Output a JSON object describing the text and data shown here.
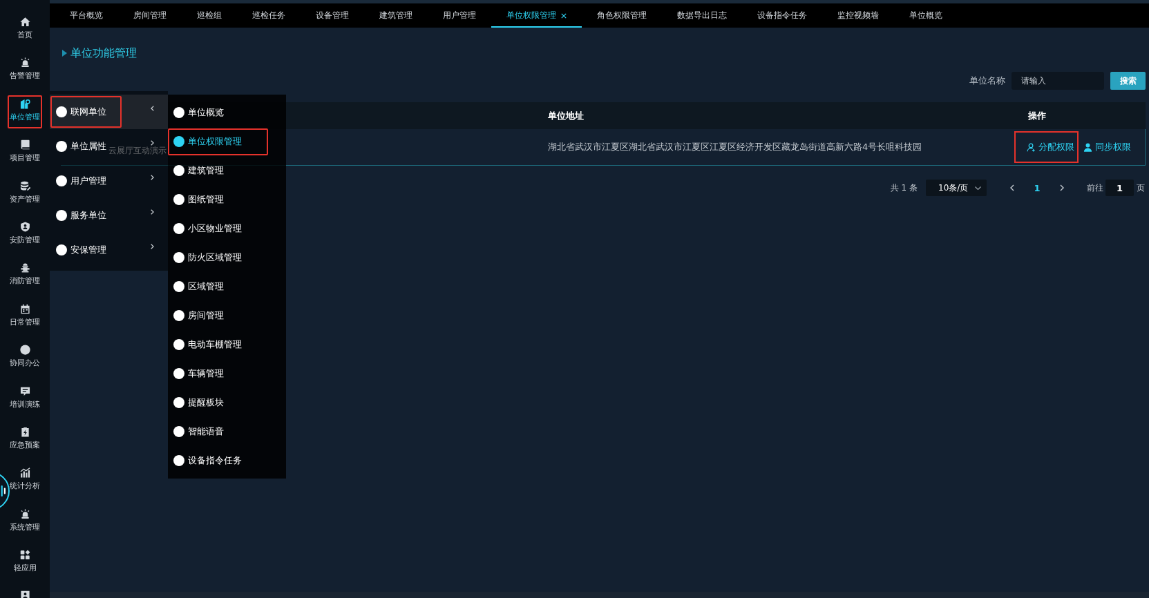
{
  "sidebar": {
    "items": [
      {
        "label": "首页",
        "selected": false,
        "highlighted": false
      },
      {
        "label": "告警管理",
        "selected": false,
        "highlighted": false
      },
      {
        "label": "单位管理",
        "selected": true,
        "highlighted": true
      },
      {
        "label": "项目管理",
        "selected": false,
        "highlighted": false
      },
      {
        "label": "资产管理",
        "selected": false,
        "highlighted": false
      },
      {
        "label": "安防管理",
        "selected": false,
        "highlighted": false
      },
      {
        "label": "消防管理",
        "selected": false,
        "highlighted": false
      },
      {
        "label": "日常管理",
        "selected": false,
        "highlighted": false
      },
      {
        "label": "协同办公",
        "selected": false,
        "highlighted": false
      },
      {
        "label": "培训演练",
        "selected": false,
        "highlighted": false
      },
      {
        "label": "应急预案",
        "selected": false,
        "highlighted": false
      },
      {
        "label": "统计分析",
        "selected": false,
        "highlighted": false
      },
      {
        "label": "系统管理",
        "selected": false,
        "highlighted": false
      },
      {
        "label": "轻应用",
        "selected": false,
        "highlighted": false
      },
      {
        "selected": false,
        "highlighted": false
      }
    ]
  },
  "tabs": [
    {
      "label": "平台概览",
      "selected": false
    },
    {
      "label": "房间管理",
      "selected": false
    },
    {
      "label": "巡检组",
      "selected": false
    },
    {
      "label": "巡检任务",
      "selected": false
    },
    {
      "label": "设备管理",
      "selected": false
    },
    {
      "label": "建筑管理",
      "selected": false
    },
    {
      "label": "用户管理",
      "selected": false
    },
    {
      "label": "单位权限管理",
      "selected": true
    },
    {
      "label": "角色权限管理",
      "selected": false
    },
    {
      "label": "数据导出日志",
      "selected": false
    },
    {
      "label": "设备指令任务",
      "selected": false
    },
    {
      "label": "监控视频墙",
      "selected": false
    },
    {
      "label": "单位概览",
      "selected": false
    }
  ],
  "page_title": "单位功能管理",
  "search": {
    "label": "单位名称",
    "placeholder": "请输入",
    "button": "搜索"
  },
  "table": {
    "columns": [
      "单位地址",
      "操作"
    ],
    "rows": [
      {
        "column_1": "云展厅互动演示",
        "address": "湖北省武汉市江夏区湖北省武汉市江夏区江夏区经济开发区藏龙岛街道高新六路4号长咀科技园",
        "actions": [
          {
            "label": "分配权限",
            "highlighted": true
          },
          {
            "label": "同步权限",
            "highlighted": false
          }
        ]
      }
    ]
  },
  "pagination": {
    "total": "共 1 条",
    "page_size": "10条/页",
    "pages": [
      {
        "label": "1",
        "selected": true
      }
    ],
    "goto_label": "前往",
    "goto_value": "1",
    "goto_suffix": "页"
  },
  "menu": {
    "items": [
      {
        "label": "联网单位",
        "expanded": true,
        "highlighted": true
      },
      {
        "label": "单位属性",
        "expanded": false,
        "highlighted": false
      },
      {
        "label": "用户管理",
        "expanded": false,
        "highlighted": false
      },
      {
        "label": "服务单位",
        "expanded": false,
        "highlighted": false
      },
      {
        "label": "安保管理",
        "expanded": false,
        "highlighted": false
      }
    ]
  },
  "submenu": {
    "items": [
      {
        "label": "单位概览",
        "selected": false,
        "highlighted": false
      },
      {
        "label": "单位权限管理",
        "selected": true,
        "highlighted": true
      },
      {
        "label": "建筑管理",
        "selected": false,
        "highlighted": false
      },
      {
        "label": "图纸管理",
        "selected": false,
        "highlighted": false
      },
      {
        "label": "小区物业管理",
        "selected": false,
        "highlighted": false
      },
      {
        "label": "防火区域管理",
        "selected": false,
        "highlighted": false
      },
      {
        "label": "区域管理",
        "selected": false,
        "highlighted": false
      },
      {
        "label": "房间管理",
        "selected": false,
        "highlighted": false
      },
      {
        "label": "电动车棚管理",
        "selected": false,
        "highlighted": false
      },
      {
        "label": "车辆管理",
        "selected": false,
        "highlighted": false
      },
      {
        "label": "提醒板块",
        "selected": false,
        "highlighted": false
      },
      {
        "label": "智能语音",
        "selected": false,
        "highlighted": false
      },
      {
        "label": "设备指令任务",
        "selected": false,
        "highlighted": false
      }
    ]
  }
}
